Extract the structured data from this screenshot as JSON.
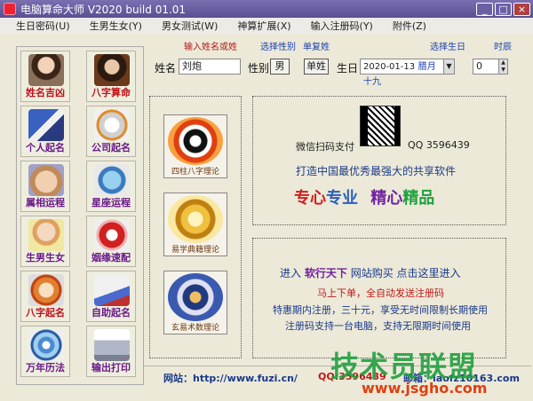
{
  "window": {
    "title": "电脑算命大师  V2020 build 01.01"
  },
  "menu": [
    "生日密码(U)",
    "生男生女(Y)",
    "男女测试(W)",
    "神算扩展(X)",
    "输入注册码(Y)",
    "附件(Z)"
  ],
  "left_buttons": [
    "姓名吉凶",
    "八字算命",
    "个人起名",
    "公司起名",
    "属相运程",
    "星座运程",
    "生男生女",
    "姻缘速配",
    "八字起名",
    "自助起名",
    "万年历法",
    "输出打印"
  ],
  "hints": {
    "name": "输入姓名或姓",
    "gender": "选择性别",
    "compound": "单复姓",
    "birthday": "选择生日",
    "hour": "时辰"
  },
  "form": {
    "name_label": "姓名",
    "name_value": "刘炮",
    "gender_label": "性别",
    "gender_value": "男",
    "surname_value": "单姓",
    "birthday_label": "生日",
    "date_value": "2020-01-13",
    "lunar_value": "腊月十九",
    "hour_value": "0"
  },
  "books": [
    "四柱八字理论",
    "易学典籍理论",
    "玄易术数理论"
  ],
  "promo": {
    "wechat": "微信扫码支付",
    "qq": "QQ 3596439",
    "slogan": "打造中国最优秀最强大的共享软件",
    "tagline_parts": [
      "专心",
      "专业",
      "精心",
      "精品"
    ]
  },
  "shop": {
    "line1_prefix": "进入",
    "line1_brand": "软行天下",
    "line1_suffix": "网站购买  点击这里进入",
    "line2": "马上下单，全自动发送注册码",
    "line3": "特惠期内注册，三十元，享受无时间限制长期使用",
    "line4": "注册码支持一台电脑，支持无限期时间使用"
  },
  "footer": {
    "site": "网站：http://www.fuzi.cn/",
    "qq": "QQ:3596439",
    "mail": "邮箱：laofz10163.com"
  },
  "watermark": {
    "big": "技术员联盟",
    "small": "www.jsgho.com"
  },
  "colors": {
    "accent_red": "#c0101a",
    "accent_purple": "#6a1a8a",
    "title_bar": "#5a4f92"
  }
}
